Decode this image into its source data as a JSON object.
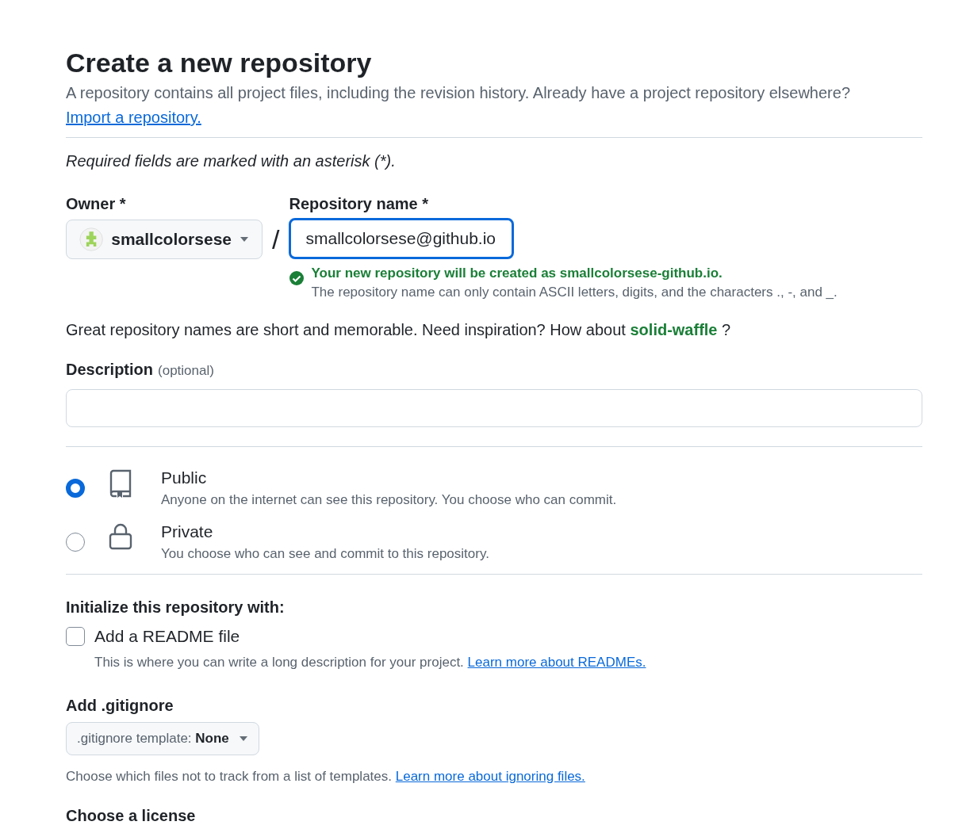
{
  "header": {
    "title": "Create a new repository",
    "intro": "A repository contains all project files, including the revision history. Already have a project repository elsewhere?",
    "import_link": "Import a repository."
  },
  "required_note": "Required fields are marked with an asterisk (*).",
  "owner": {
    "label": "Owner *",
    "value": "smallcolorsese"
  },
  "separator": "/",
  "repo_name": {
    "label": "Repository name *",
    "value": "smallcolorsese@github.io",
    "focused": true,
    "success": "Your new repository will be created as smallcolorsese-github.io.",
    "hint": "The repository name can only contain ASCII letters, digits, and the characters ., -, and _."
  },
  "inspiration": {
    "text": "Great repository names are short and memorable. Need inspiration? How about",
    "suggestion": "solid-waffle",
    "suffix": "?"
  },
  "description": {
    "label": "Description",
    "hint": "(optional)"
  },
  "visibility": [
    {
      "kind": "book",
      "title": "Public",
      "text": "Anyone on the internet can see this repository. You choose who can commit.",
      "selected": true
    },
    {
      "kind": "lock",
      "title": "Private",
      "text": "You choose who can see and commit to this repository.",
      "selected": false
    }
  ],
  "initialize": {
    "heading": "Initialize this repository with:",
    "readme": {
      "label": "Add a README file",
      "checked": false,
      "text": "This is where you can write a long description for your project.",
      "link": "Learn more about READMEs."
    }
  },
  "gitignore": {
    "heading": "Add .gitignore",
    "button_label": ".gitignore template:",
    "button_value": "None",
    "text": "Choose which files not to track from a list of templates.",
    "link": "Learn more about ignoring files."
  },
  "license": {
    "heading": "Choose a license"
  }
}
